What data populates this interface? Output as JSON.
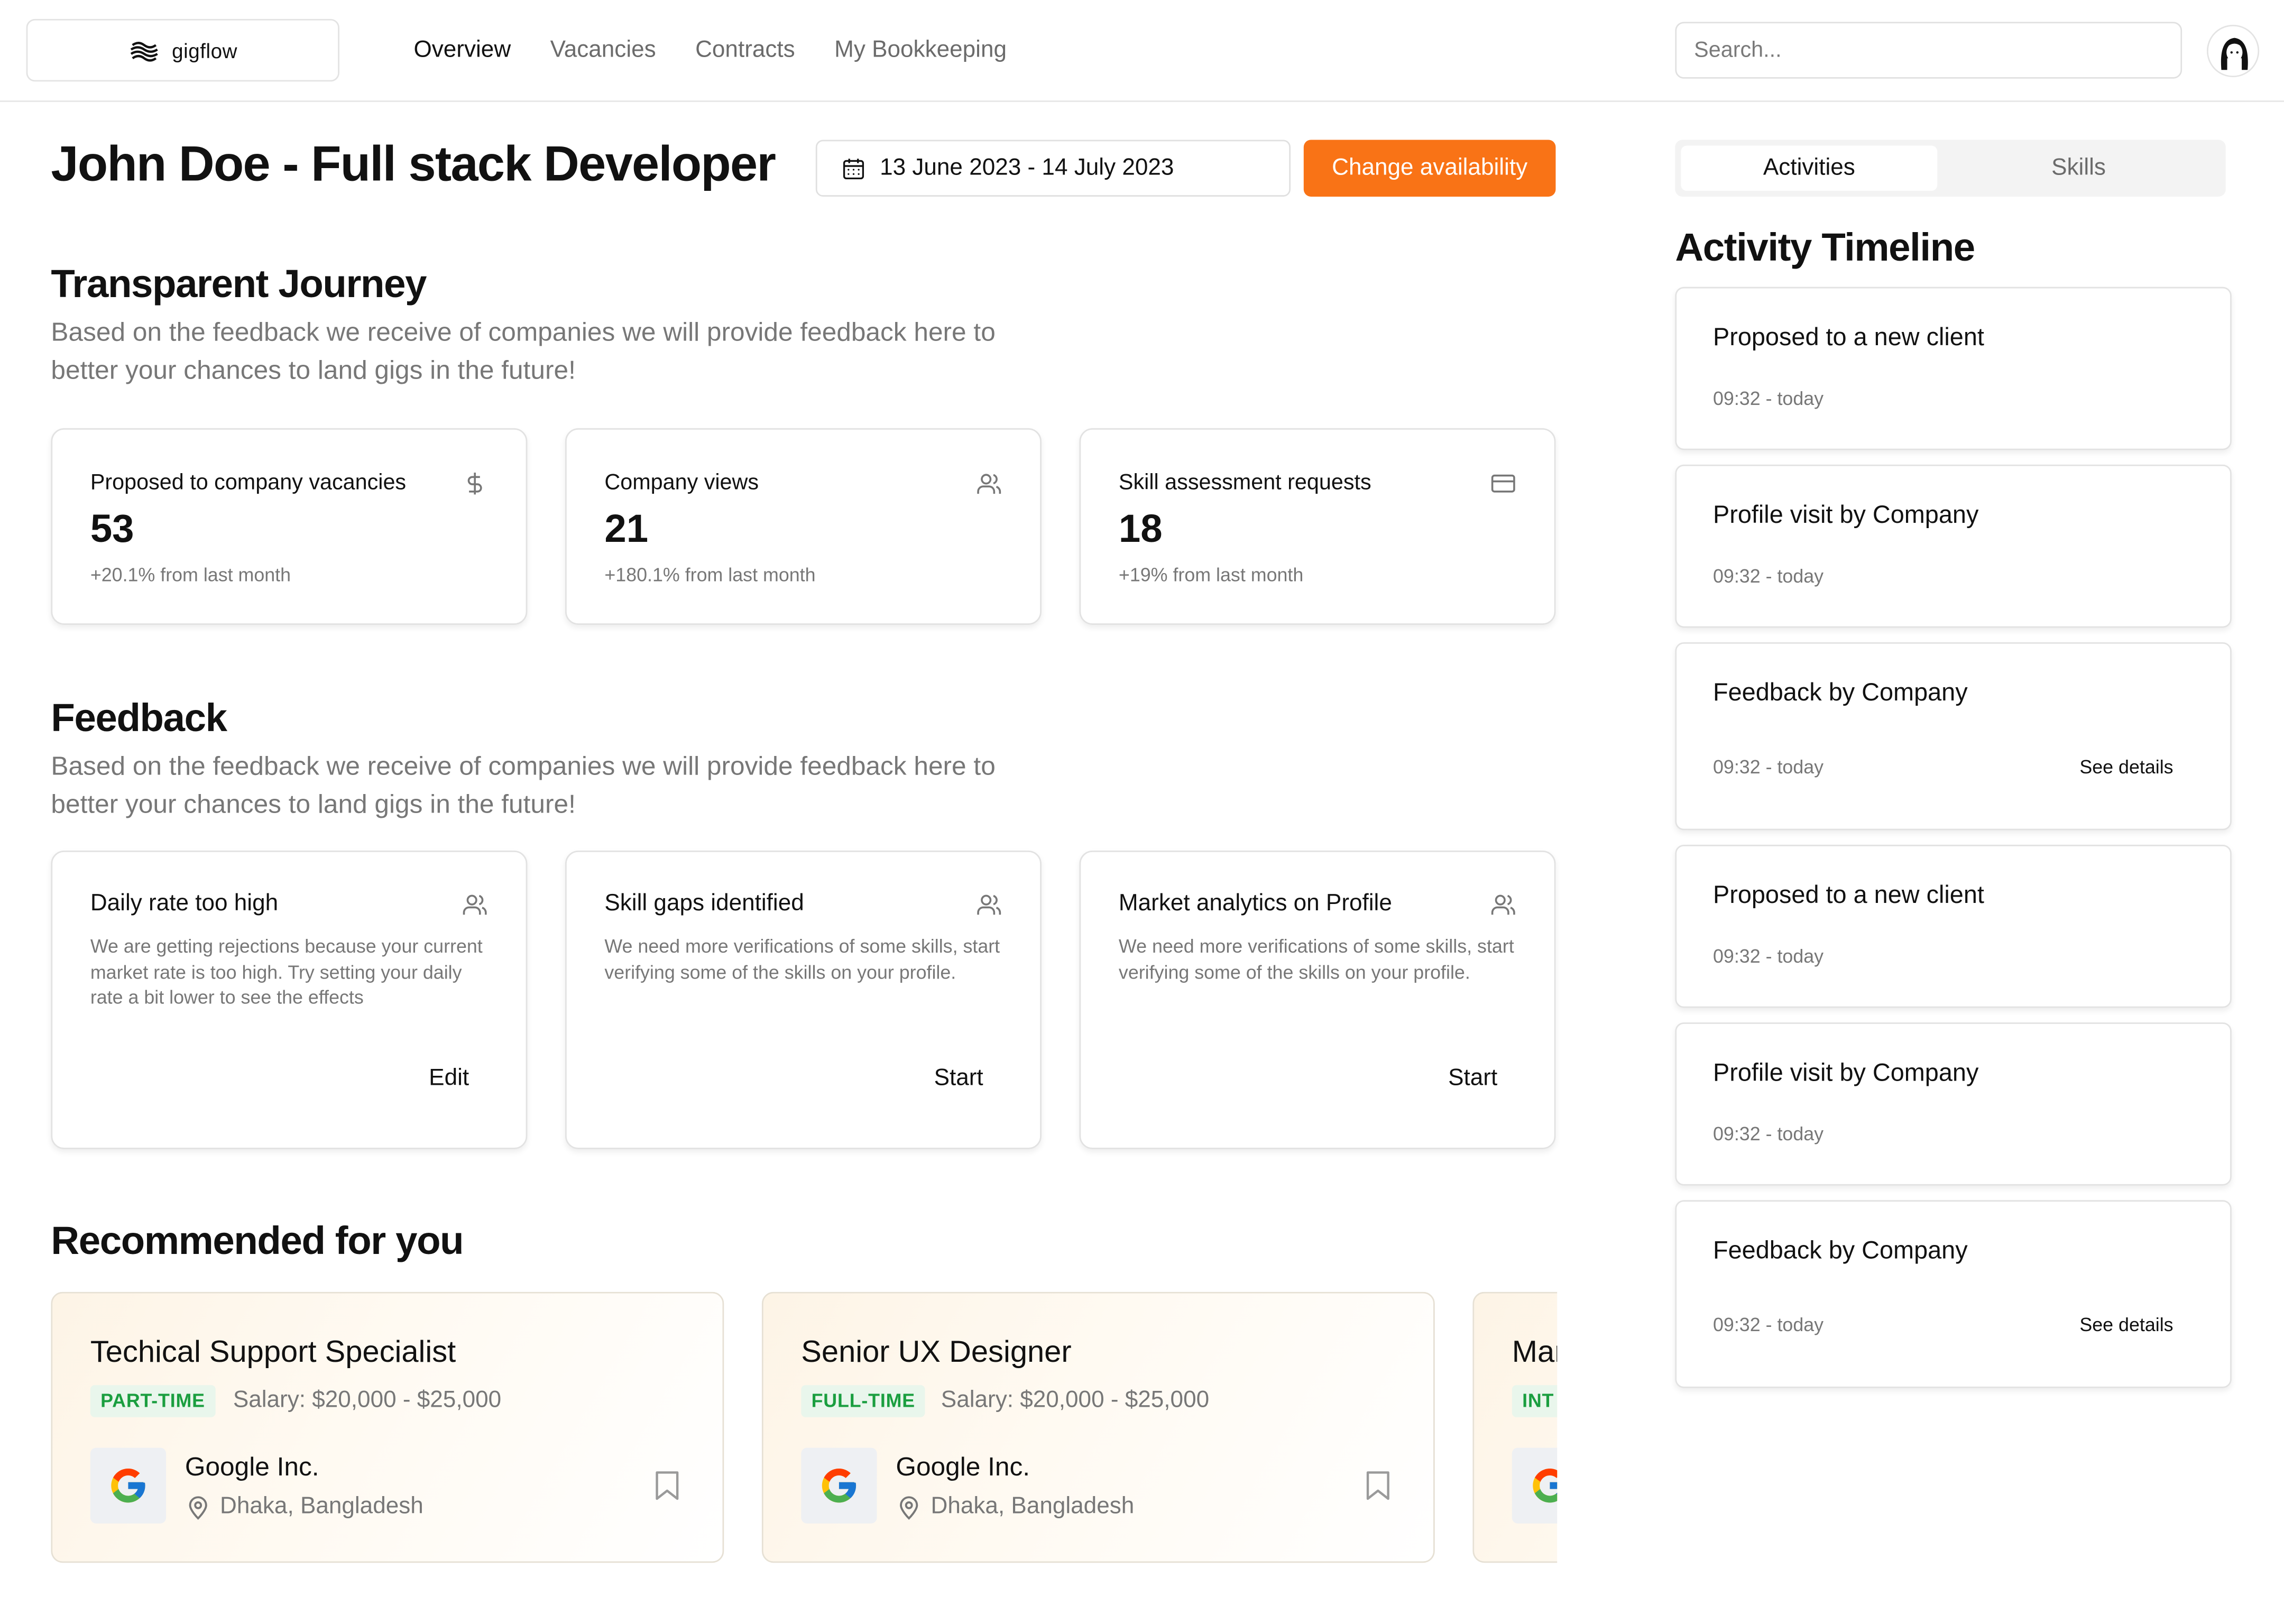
{
  "app": {
    "name": "gigflow"
  },
  "nav": {
    "items": [
      {
        "label": "Overview",
        "active": true
      },
      {
        "label": "Vacancies",
        "active": false
      },
      {
        "label": "Contracts",
        "active": false
      },
      {
        "label": "My Bookkeeping",
        "active": false
      }
    ]
  },
  "search": {
    "placeholder": "Search...",
    "value": ""
  },
  "header": {
    "title": "John Doe - Full stack Developer",
    "date_range": "13 June 2023 - 14 July 2023",
    "change_availability": "Change availability"
  },
  "journey": {
    "title": "Transparent Journey",
    "description": "Based on the feedback we receive of companies we will provide feedback here to better your chances to land gigs in the future!",
    "stats": [
      {
        "label": "Proposed to company vacancies",
        "value": "53",
        "change": "+20.1% from last month",
        "icon": "dollar-icon"
      },
      {
        "label": "Company views",
        "value": "21",
        "change": "+180.1% from last month",
        "icon": "users-icon"
      },
      {
        "label": "Skill assessment requests",
        "value": "18",
        "change": "+19% from last month",
        "icon": "credit-card-icon"
      }
    ]
  },
  "feedback": {
    "title": "Feedback",
    "description": "Based on the feedback we receive of companies we will provide feedback here to better your chances to land gigs in the future!",
    "cards": [
      {
        "title": "Daily rate too high",
        "text": "We are getting rejections because your current market rate is too high. Try setting your daily rate a bit lower to see the effects",
        "action": "Edit",
        "icon": "users-icon"
      },
      {
        "title": "Skill gaps identified",
        "text": "We need more verifications of some skills, start verifying some of the skills on your profile.",
        "action": "Start",
        "icon": "users-icon"
      },
      {
        "title": "Market analytics on Profile",
        "text": "We need more verifications of some skills, start verifying some of the skills on your profile.",
        "action": "Start",
        "icon": "users-icon"
      }
    ]
  },
  "recommended": {
    "title": "Recommended for you",
    "jobs": [
      {
        "title": "Techical Support Specialist",
        "type": "PART-TIME",
        "salary": "Salary: $20,000 - $25,000",
        "company": "Google Inc.",
        "location": "Dhaka, Bangladesh"
      },
      {
        "title": "Senior UX Designer",
        "type": "FULL-TIME",
        "salary": "Salary: $20,000 - $25,000",
        "company": "Google Inc.",
        "location": "Dhaka, Bangladesh"
      },
      {
        "title": "Mar",
        "type": "INT",
        "salary": "",
        "company": "",
        "location": ""
      }
    ]
  },
  "sidebar": {
    "tabs": [
      {
        "label": "Activities",
        "active": true
      },
      {
        "label": "Skills",
        "active": false
      }
    ],
    "timeline_title": "Activity Timeline",
    "activities": [
      {
        "title": "Proposed to a new client",
        "time": "09:32 - today",
        "link": ""
      },
      {
        "title": "Profile visit by Company",
        "time": "09:32 - today",
        "link": ""
      },
      {
        "title": "Feedback by Company",
        "time": "09:32 - today",
        "link": "See details"
      },
      {
        "title": "Proposed to a new client",
        "time": "09:32 - today",
        "link": ""
      },
      {
        "title": "Profile visit by Company",
        "time": "09:32 - today",
        "link": ""
      },
      {
        "title": "Feedback by Company",
        "time": "09:32 - today",
        "link": "See details"
      }
    ]
  },
  "colors": {
    "accent": "#f97316",
    "badge_green": "#1a9e3f",
    "badge_bg": "#e9f6ec"
  }
}
